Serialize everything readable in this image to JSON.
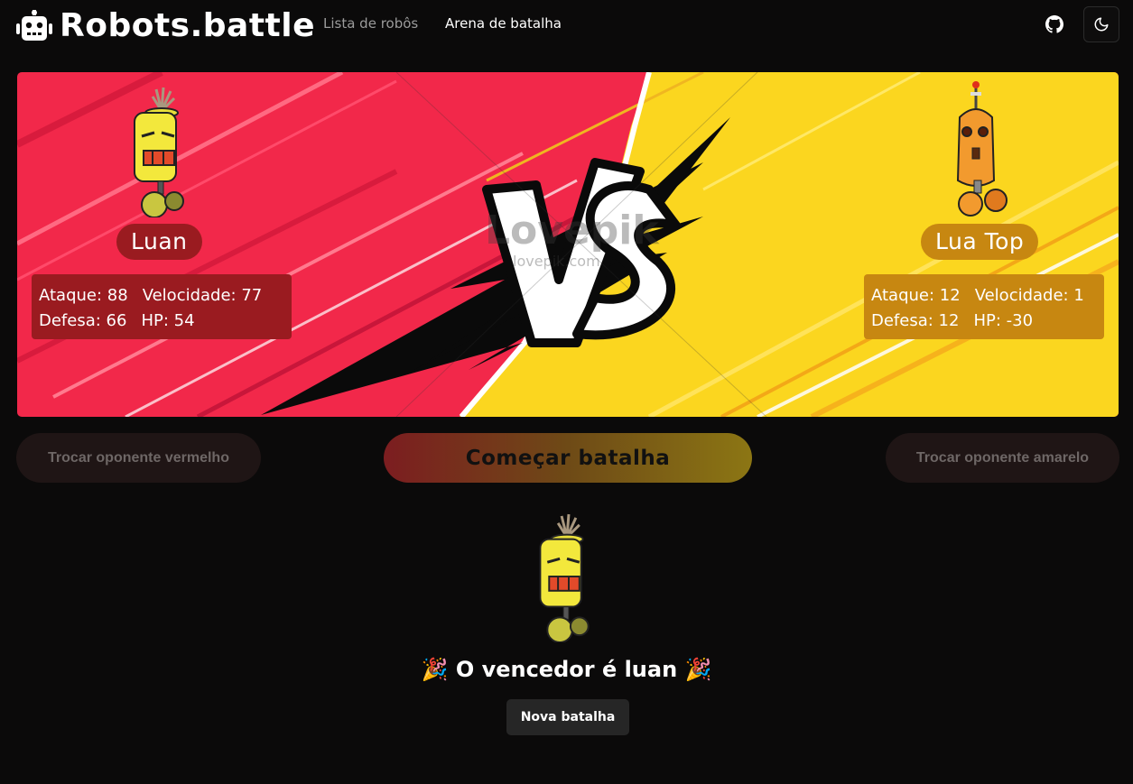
{
  "header": {
    "brand": "Robots.battle",
    "nav": [
      {
        "label": "Lista de robôs"
      },
      {
        "label": "Arena de batalha"
      }
    ]
  },
  "arena": {
    "watermark": "Lovepik",
    "watermark_sub": "lovepik.com",
    "red": {
      "name": "Luan",
      "attack_label": "Ataque: 88",
      "speed_label": "Velocidade: 77",
      "defense_label": "Defesa: 66",
      "hp_label": "HP: 54"
    },
    "yellow": {
      "name": "Lua Top",
      "attack_label": "Ataque: 12",
      "speed_label": "Velocidade: 1",
      "defense_label": "Defesa: 12",
      "hp_label": "HP: -30"
    }
  },
  "actions": {
    "swap_red": "Trocar oponente vermelho",
    "start": "Começar batalha",
    "swap_yellow": "Trocar oponente amarelo"
  },
  "result": {
    "winner_text": "🎉 O vencedor é luan 🎉",
    "new_battle": "Nova batalha"
  },
  "colors": {
    "background": "#0b0a0a",
    "red_side": "#f2284a",
    "yellow_side": "#fbd61f",
    "red_panel": "#9a1b20",
    "yellow_panel": "#c78711"
  }
}
